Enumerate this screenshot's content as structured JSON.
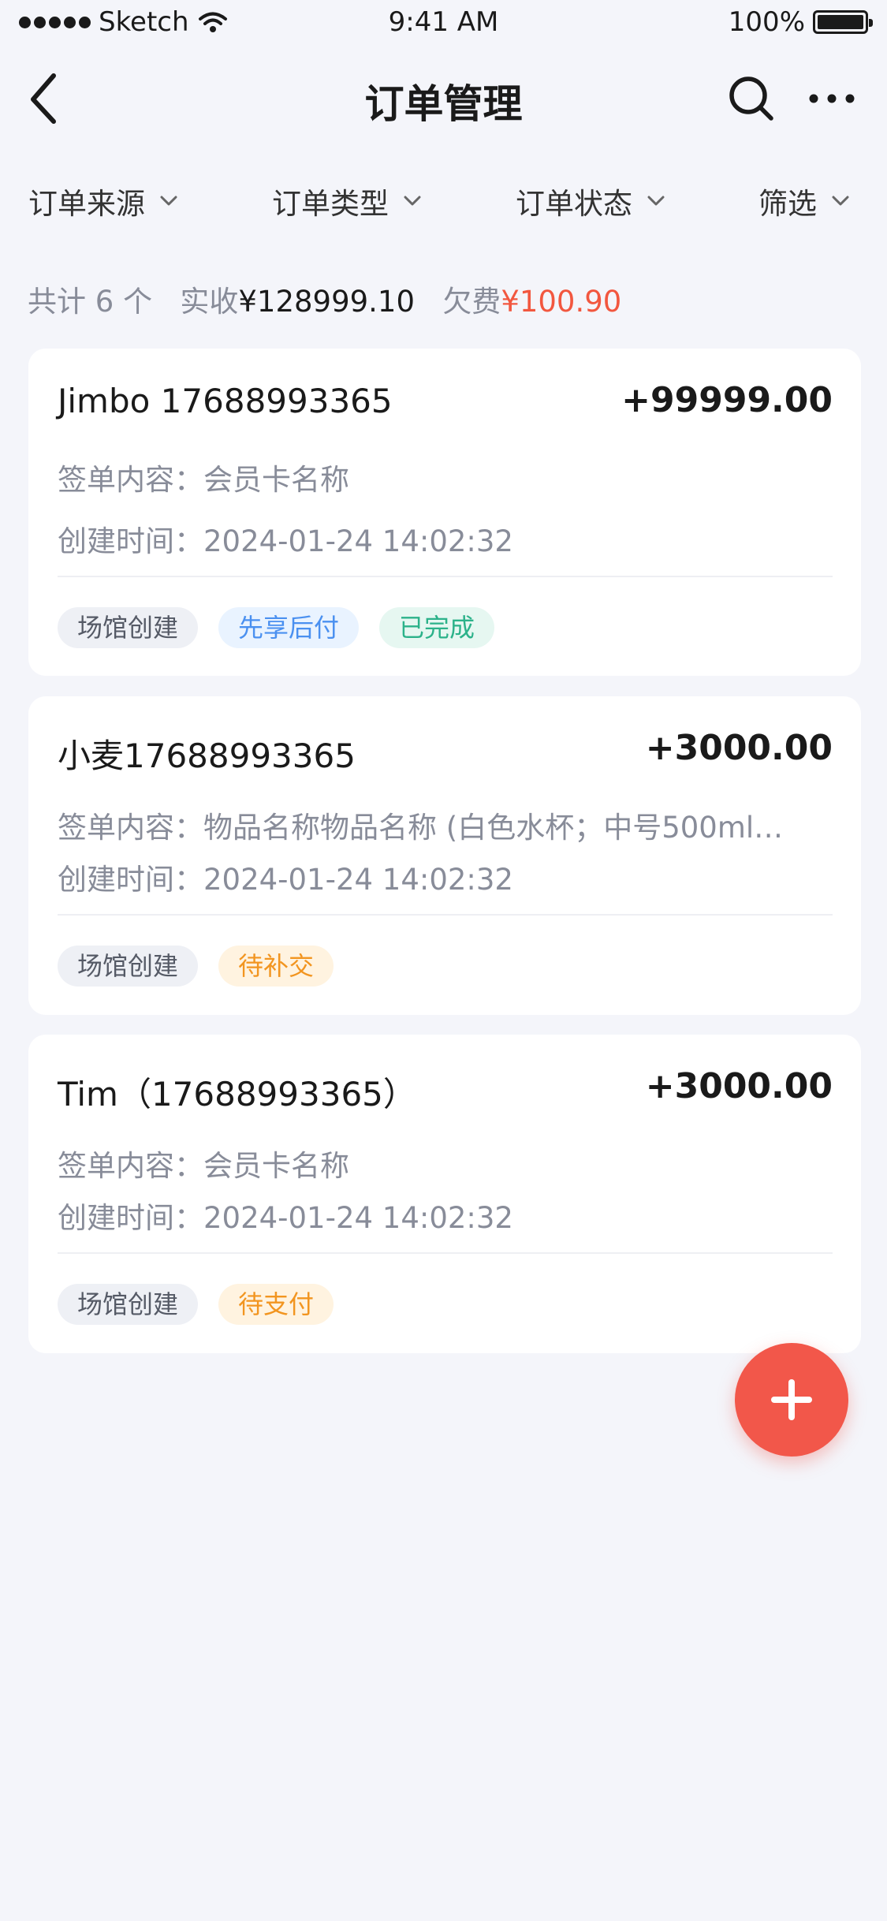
{
  "status": {
    "carrier": "Sketch",
    "time": "9:41 AM",
    "battery": "100%"
  },
  "nav": {
    "title": "订单管理"
  },
  "filters": [
    "订单来源",
    "订单类型",
    "订单状态",
    "筛选"
  ],
  "summary": {
    "count_label": "共计 6 个",
    "received_label": "实收",
    "received_value": "¥128999.10",
    "owed_label": "欠费",
    "owed_value": "¥100.90"
  },
  "orders": [
    {
      "name": "Jimbo 17688993365",
      "amount": "+99999.00",
      "content": "签单内容：会员卡名称",
      "time": "创建时间：2024-01-24 14:02:32",
      "tags": [
        "场馆创建",
        "先享后付",
        "已完成"
      ]
    },
    {
      "name": "小麦17688993365",
      "amount": "+3000.00",
      "content": "签单内容：物品名称物品名称 (白色水杯；中号500ml…",
      "time": "创建时间：2024-01-24 14:02:32",
      "tags": [
        "场馆创建",
        "待补交"
      ]
    },
    {
      "name": "Tim（17688993365）",
      "amount": "+3000.00",
      "content": "签单内容：会员卡名称",
      "time": "创建时间：2024-01-24 14:02:32",
      "tags": [
        "场馆创建",
        "待支付"
      ]
    }
  ],
  "colors": {
    "accent": "#f2574a",
    "owed": "#f2573f",
    "background": "#f4f5fa"
  },
  "icons": [
    "back-icon",
    "search-icon",
    "more-icon",
    "chevron-down-icon",
    "add-icon"
  ]
}
